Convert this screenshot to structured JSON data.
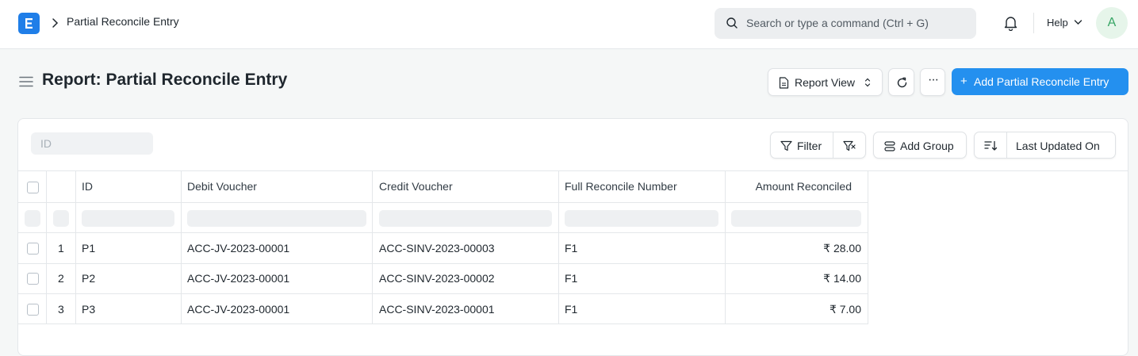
{
  "navbar": {
    "breadcrumb": "Partial Reconcile Entry",
    "search_placeholder": "Search or type a command (Ctrl + G)",
    "help_label": "Help",
    "avatar_initial": "A"
  },
  "page": {
    "title": "Report: Partial Reconcile Entry",
    "view_label": "Report View",
    "more_label": "···",
    "primary_label": "Add Partial Reconcile Entry"
  },
  "toolbar": {
    "id_placeholder": "ID",
    "filter_label": "Filter",
    "group_label": "Add Group",
    "sort_label": "Last Updated On"
  },
  "table": {
    "columns": [
      "ID",
      "Debit Voucher",
      "Credit Voucher",
      "Full Reconcile Number",
      "Amount Reconciled"
    ],
    "rows": [
      {
        "index": "1",
        "id": "P1",
        "debit": "ACC-JV-2023-00001",
        "credit": "ACC-SINV-2023-00003",
        "full": "F1",
        "amount": "₹ 28.00"
      },
      {
        "index": "2",
        "id": "P2",
        "debit": "ACC-JV-2023-00001",
        "credit": "ACC-SINV-2023-00002",
        "full": "F1",
        "amount": "₹ 14.00"
      },
      {
        "index": "3",
        "id": "P3",
        "debit": "ACC-JV-2023-00001",
        "credit": "ACC-SINV-2023-00001",
        "full": "F1",
        "amount": "₹ 7.00"
      }
    ]
  },
  "colors": {
    "primary": "#2490ef",
    "logo": "#1f7ee8",
    "avatar_bg": "#e6f5ea",
    "avatar_fg": "#36a564"
  }
}
